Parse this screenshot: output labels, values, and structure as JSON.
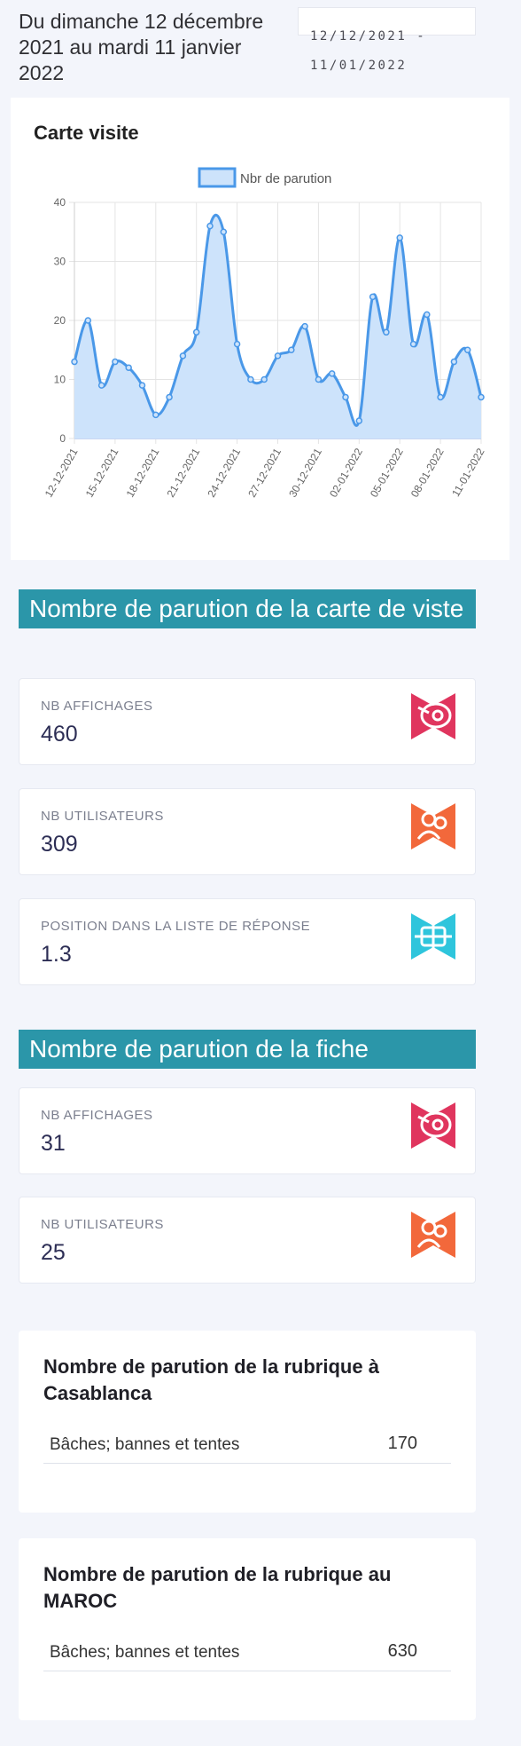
{
  "header": {
    "period_title": "Du dimanche 12 décembre 2021 au mardi 11 janvier 2022",
    "date_range": "12/12/2021 - 11/01/2022"
  },
  "chart_title": "Carte visite",
  "chart_data": {
    "type": "line",
    "legend_position": "top",
    "grid": true,
    "ylim": [
      0,
      40
    ],
    "yticks": [
      0,
      10,
      20,
      30,
      40
    ],
    "x": [
      "12-12-2021",
      "13-12-2021",
      "14-12-2021",
      "15-12-2021",
      "16-12-2021",
      "17-12-2021",
      "18-12-2021",
      "19-12-2021",
      "20-12-2021",
      "21-12-2021",
      "22-12-2021",
      "23-12-2021",
      "24-12-2021",
      "25-12-2021",
      "26-12-2021",
      "27-12-2021",
      "28-12-2021",
      "29-12-2021",
      "30-12-2021",
      "31-12-2021",
      "01-01-2022",
      "02-01-2022",
      "03-01-2022",
      "04-01-2022",
      "05-01-2022",
      "06-01-2022",
      "07-01-2022",
      "08-01-2022",
      "09-01-2022",
      "10-01-2022",
      "11-01-2022"
    ],
    "xtick_labels": [
      "12-12-2021",
      "15-12-2021",
      "18-12-2021",
      "21-12-2021",
      "24-12-2021",
      "27-12-2021",
      "30-12-2021",
      "02-01-2022",
      "05-01-2022",
      "08-01-2022",
      "11-01-2022"
    ],
    "series": [
      {
        "name": "Nbr de parution",
        "color": "#4a98e8",
        "fill": "#cde3fb",
        "values": [
          13,
          20,
          9,
          13,
          12,
          9,
          4,
          7,
          14,
          18,
          36,
          35,
          16,
          10,
          10,
          14,
          15,
          19,
          10,
          11,
          7,
          3,
          24,
          18,
          34,
          16,
          21,
          7,
          13,
          15,
          7
        ]
      }
    ]
  },
  "carte_section": {
    "title": "Nombre de parution de la carte de viste",
    "stats": [
      {
        "label": "NB AFFICHAGES",
        "value": "460",
        "icon": "eye-icon",
        "color": "#e0355e"
      },
      {
        "label": "NB UTILISATEURS",
        "value": "309",
        "icon": "users-icon",
        "color": "#f2683b"
      },
      {
        "label": "POSITION DANS LA LISTE DE RÉPONSE",
        "value": "1.3",
        "icon": "list-position-icon",
        "color": "#2ec5dc"
      }
    ]
  },
  "fiche_section": {
    "title": "Nombre de parution de la fiche",
    "stats": [
      {
        "label": "NB AFFICHAGES",
        "value": "31",
        "icon": "eye-icon",
        "color": "#e0355e"
      },
      {
        "label": "NB UTILISATEURS",
        "value": "25",
        "icon": "users-icon",
        "color": "#f2683b"
      }
    ]
  },
  "rubrique_casablanca": {
    "title": "Nombre de parution de la rubrique à Casablanca",
    "rows": [
      {
        "name": "Bâches; bannes et tentes",
        "count": "170"
      }
    ]
  },
  "rubrique_maroc": {
    "title": "Nombre de parution de la rubrique au MAROC",
    "rows": [
      {
        "name": "Bâches; bannes et tentes",
        "count": "630"
      }
    ]
  }
}
